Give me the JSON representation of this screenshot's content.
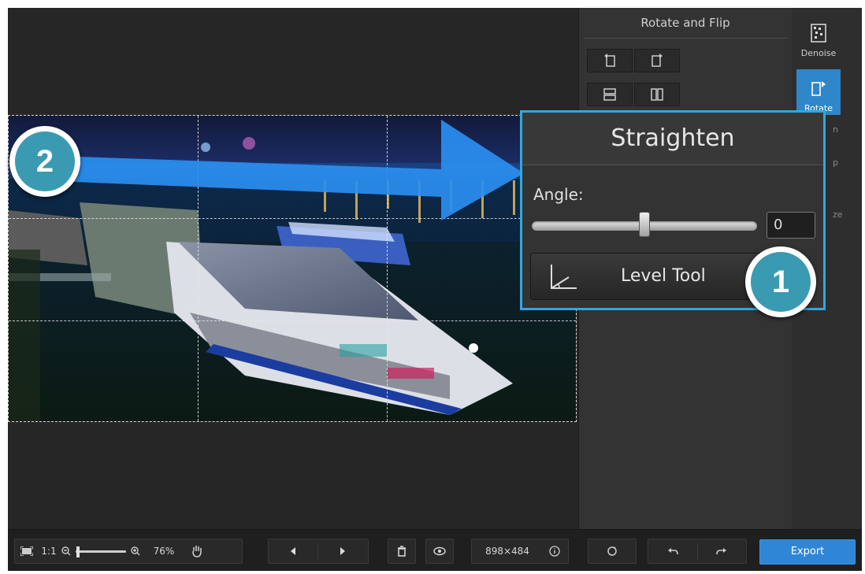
{
  "panel": {
    "title": "Rotate and Flip"
  },
  "side_tools": [
    {
      "label": "Denoise",
      "icon": "denoise-icon"
    },
    {
      "label": "Rotate",
      "icon": "rotate-icon",
      "active": true
    }
  ],
  "straighten": {
    "title": "Straighten",
    "angle_label": "Angle:",
    "angle_value": "0",
    "level_tool_label": "Level Tool"
  },
  "annotations": {
    "marker_1": "1",
    "marker_2": "2",
    "accent": "#2fa8e0",
    "arrow_color": "#2b8ef0"
  },
  "toolbar": {
    "fit_icon": "fit-screen-icon",
    "actual_size": "1:1",
    "zoom_percent": "76%",
    "dimensions": "898×484",
    "export_label": "Export"
  },
  "colors": {
    "accent_blue": "#2f86c9",
    "marker_teal": "#3a9ab2"
  }
}
